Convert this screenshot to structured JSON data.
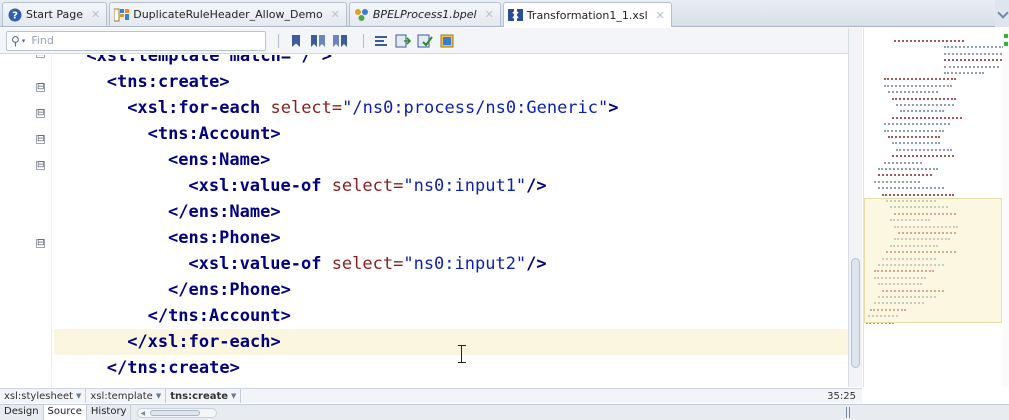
{
  "tabs": [
    {
      "label": "Start Page",
      "icon": "help-circle-icon",
      "italic": false,
      "active": false
    },
    {
      "label": "DuplicateRuleHeader_Allow_Demo",
      "icon": "rules-icon",
      "italic": false,
      "active": false
    },
    {
      "label": "BPELProcess1.bpel",
      "icon": "bpel-process-icon",
      "italic": true,
      "active": false
    },
    {
      "label": "Transformation1_1.xsl",
      "icon": "xsl-transform-icon",
      "italic": false,
      "active": true
    }
  ],
  "toolbar": {
    "find_placeholder": "Find"
  },
  "editor": {
    "lines": [
      {
        "indent": 2,
        "parts": [
          {
            "t": "<xsl:template match=\"/\">",
            "c": "tag"
          }
        ],
        "fold": true,
        "partial": true
      },
      {
        "indent": 4,
        "parts": [
          {
            "t": "<tns:create>",
            "c": "tag"
          }
        ],
        "fold": true
      },
      {
        "indent": 6,
        "parts": [
          {
            "t": "<xsl:for-each ",
            "c": "tag"
          },
          {
            "t": "select=",
            "c": "attr"
          },
          {
            "t": "\"/ns0:process/ns0:Generic\"",
            "c": "str"
          },
          {
            "t": ">",
            "c": "tag"
          }
        ],
        "fold": true
      },
      {
        "indent": 8,
        "parts": [
          {
            "t": "<tns:Account>",
            "c": "tag"
          }
        ],
        "fold": true
      },
      {
        "indent": 10,
        "parts": [
          {
            "t": "<ens:Name>",
            "c": "tag"
          }
        ],
        "fold": true
      },
      {
        "indent": 12,
        "parts": [
          {
            "t": "<xsl:value-of ",
            "c": "tag"
          },
          {
            "t": "select=",
            "c": "attr"
          },
          {
            "t": "\"ns0:input1\"",
            "c": "str"
          },
          {
            "t": "/>",
            "c": "tag"
          }
        ],
        "fold": false
      },
      {
        "indent": 10,
        "parts": [
          {
            "t": "</ens:Name>",
            "c": "tag"
          }
        ],
        "fold": false
      },
      {
        "indent": 10,
        "parts": [
          {
            "t": "<ens:Phone>",
            "c": "tag"
          }
        ],
        "fold": true
      },
      {
        "indent": 12,
        "parts": [
          {
            "t": "<xsl:value-of ",
            "c": "tag"
          },
          {
            "t": "select=",
            "c": "attr"
          },
          {
            "t": "\"ns0:input2\"",
            "c": "str"
          },
          {
            "t": "/>",
            "c": "tag"
          }
        ],
        "fold": false
      },
      {
        "indent": 10,
        "parts": [
          {
            "t": "</ens:Phone>",
            "c": "tag"
          }
        ],
        "fold": false
      },
      {
        "indent": 8,
        "parts": [
          {
            "t": "</tns:Account>",
            "c": "tag"
          }
        ],
        "fold": false
      },
      {
        "indent": 6,
        "parts": [
          {
            "t": "</xsl:for-each>",
            "c": "tag"
          }
        ],
        "fold": false,
        "current": true
      },
      {
        "indent": 4,
        "parts": [
          {
            "t": "</tns:create>",
            "c": "tag"
          }
        ],
        "fold": false
      }
    ]
  },
  "breadcrumbs": [
    {
      "label": "xsl:stylesheet",
      "current": false
    },
    {
      "label": "xsl:template",
      "current": false
    },
    {
      "label": "tns:create",
      "current": true
    }
  ],
  "status": {
    "position": "35:25"
  },
  "bottom_tabs": [
    {
      "label": "Design",
      "active": false
    },
    {
      "label": "Source",
      "active": true
    },
    {
      "label": "History",
      "active": false
    }
  ],
  "colors": {
    "tag": "#00007f",
    "attribute": "#8b1e1e",
    "string": "#0b1fb5",
    "current_line": "#fbf6e0"
  }
}
